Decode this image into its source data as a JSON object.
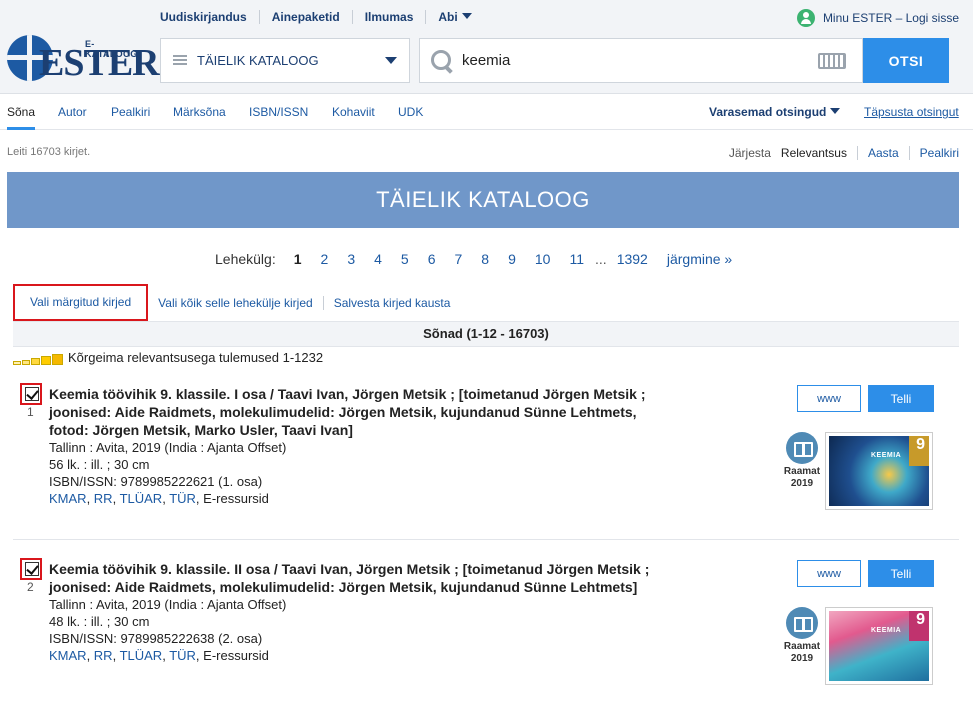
{
  "topnav": {
    "items": [
      "Uudiskirjandus",
      "Ainepaketid",
      "Ilmumas",
      "Abi"
    ]
  },
  "login": {
    "label": "Minu ESTER – Logi sisse"
  },
  "logo": {
    "small": "E-KATALOOG",
    "big": "ESTER"
  },
  "catalog_select": {
    "value": "TÄIELIK KATALOOG"
  },
  "search": {
    "value": "keemia",
    "button_label": "OTSI"
  },
  "tabs": {
    "items": [
      "Sõna",
      "Autor",
      "Pealkiri",
      "Märksõna",
      "ISBN/ISSN",
      "Kohaviit",
      "UDK"
    ],
    "prev_searches": "Varasemad otsingud",
    "refine": "Täpsusta otsingut"
  },
  "results": {
    "found": "Leiti 16703 kirjet.",
    "sort_label": "Järjesta",
    "sort_options": [
      "Relevantsus",
      "Aasta",
      "Pealkiri"
    ]
  },
  "banner": {
    "title": "TÄIELIK KATALOOG"
  },
  "pager": {
    "label": "Lehekülg:",
    "pages": [
      "1",
      "2",
      "3",
      "4",
      "5",
      "6",
      "7",
      "8",
      "9",
      "10",
      "11"
    ],
    "dots": "...",
    "last": "1392",
    "next": "järgmine »"
  },
  "actions": {
    "select_marked": "Vali märgitud kirjed",
    "select_all": "Vali kõik selle lehekülje kirjed",
    "save_folder": "Salvesta kirjed kausta"
  },
  "words_header": "Sõnad (1-12 - 16703)",
  "relevance_text": "Kõrgeima relevantsusega tulemused 1-1232",
  "records": [
    {
      "num": "1",
      "title": "Keemia töövihik 9. klassile. I osa / Taavi Ivan, Jörgen Metsik ; [toimetanud Jörgen Metsik ; joonised: Aide Raidmets, molekulimudelid: Jörgen Metsik, kujundanud Sünne Lehtmets, fotod: Jörgen Metsik, Marko Usler, Taavi Ivan]",
      "publisher": "Tallinn : Avita, 2019 (India : Ajanta Offset)",
      "pages": "56 lk. : ill. ; 30 cm",
      "isbn": "ISBN/ISSN:  9789985222621 (1. osa)",
      "links": [
        "KMAR",
        "RR",
        "TLÜAR",
        "TÜR"
      ],
      "eres": "E-ressursid",
      "www": "www",
      "order": "Telli",
      "type": "Raamat",
      "year": "2019",
      "cover_title": "KEEMIA",
      "cover_num": "9"
    },
    {
      "num": "2",
      "title": "Keemia töövihik 9. klassile. II osa / Taavi Ivan, Jörgen Metsik ; [toimetanud Jörgen Metsik ; joonised: Aide Raidmets, molekulimudelid: Jörgen Metsik, kujundanud Sünne Lehtmets]",
      "publisher": "Tallinn : Avita, 2019 (India : Ajanta Offset)",
      "pages": "48 lk. : ill. ; 30 cm",
      "isbn": "ISBN/ISSN:  9789985222638 (2. osa)",
      "links": [
        "KMAR",
        "RR",
        "TLÜAR",
        "TÜR"
      ],
      "eres": "E-ressursid",
      "www": "www",
      "order": "Telli",
      "type": "Raamat",
      "year": "2019",
      "cover_title": "KEEMIA",
      "cover_num": "9"
    }
  ],
  "colors": {
    "accent": "#2d8ee8",
    "navy": "#1c3f72",
    "banner": "#7097c9",
    "highlight_box": "#d9161c"
  }
}
